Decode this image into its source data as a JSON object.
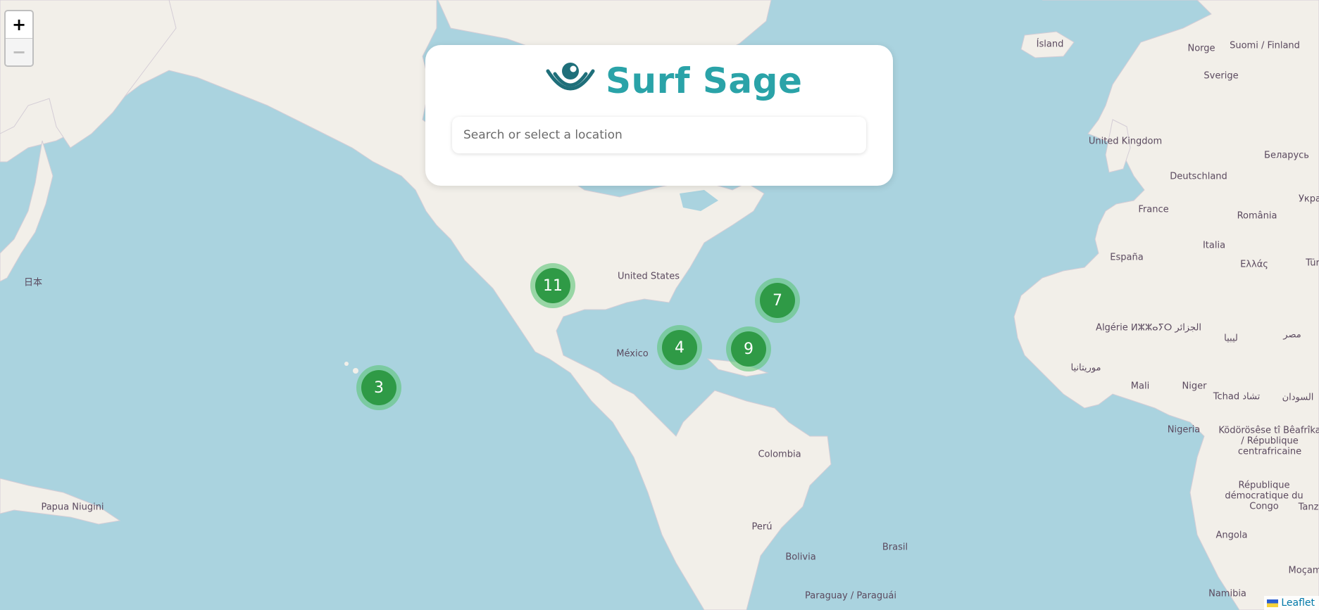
{
  "app": {
    "title": "Surf Sage"
  },
  "search": {
    "placeholder": "Search or select a location",
    "value": ""
  },
  "zoom": {
    "in_label": "+",
    "out_label": "−"
  },
  "attribution": {
    "label": "Leaflet"
  },
  "clusters": [
    {
      "count": "11"
    },
    {
      "count": "7"
    },
    {
      "count": "4"
    },
    {
      "count": "9"
    },
    {
      "count": "3"
    }
  ],
  "places": [
    "Ísland",
    "Norge",
    "Suomi / Finland",
    "Sverige",
    "United Kingdom",
    "Беларусь",
    "Deutschland",
    "France",
    "Укра",
    "România",
    "Italia",
    "España",
    "Ελλάς",
    "Tür",
    "Algérie ⵍⵣⵣⴰⵢⵔ الجزائر",
    "ليبيا",
    "مصر",
    "موريتانيا",
    "Mali",
    "Niger",
    "Tchad تشاد",
    "السودان",
    "Nigeria",
    "Ködörösêse tî Bêafrîka / République centrafricaine",
    "République démocratique du Congo",
    "Tanz",
    "Angola",
    "Namibia",
    "Moçam",
    "United States",
    "México",
    "Colombia",
    "Perú",
    "Brasil",
    "Bolivia",
    "Paraguay / Paraguái",
    "日本",
    "Papua Niugini"
  ],
  "colors": {
    "water": "#aad3df",
    "land": "#f2efe9",
    "cluster_inner": "#2f9a46",
    "cluster_ring": "#5cc478",
    "brand": "#2aa3a8",
    "logo": "#1f6f7a"
  }
}
